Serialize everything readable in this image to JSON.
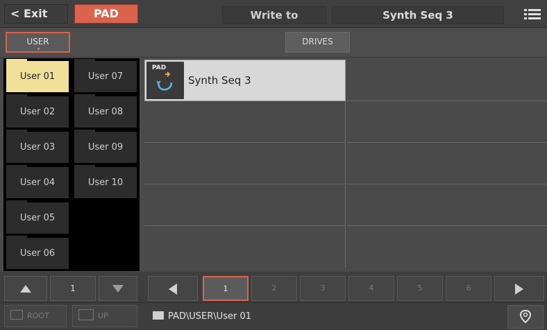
{
  "topbar": {
    "exit_label": "< Exit",
    "mode_label": "PAD",
    "write_label": "Write to",
    "destination": "Synth Seq 3",
    "menu_icon": "hamburger-menu-icon"
  },
  "sources": {
    "user_label": "USER",
    "drives_label": "DRIVES"
  },
  "folders": [
    {
      "label": "User 01",
      "selected": true
    },
    {
      "label": "User 02"
    },
    {
      "label": "User 03"
    },
    {
      "label": "User 04"
    },
    {
      "label": "User 05"
    },
    {
      "label": "User 06"
    },
    {
      "label": "User 07"
    },
    {
      "label": "User 08"
    },
    {
      "label": "User 09"
    },
    {
      "label": "User 10"
    }
  ],
  "items": [
    {
      "badge": "PAD",
      "name": "Synth Seq 3",
      "icon": "pad-sequence-icon",
      "selected": true
    }
  ],
  "folder_pager": {
    "page": "1"
  },
  "pager": {
    "pages": [
      "1",
      "2",
      "3",
      "4",
      "5",
      "6"
    ],
    "current": "1"
  },
  "bottom": {
    "root_label": "ROOT",
    "up_label": "UP",
    "path": "PAD\\USER\\User 01",
    "pin_icon": "location-pin-icon"
  },
  "colors": {
    "accent": "#d9634d",
    "selected_folder": "#f2e09a",
    "selected_item": "#d8d8d8"
  }
}
